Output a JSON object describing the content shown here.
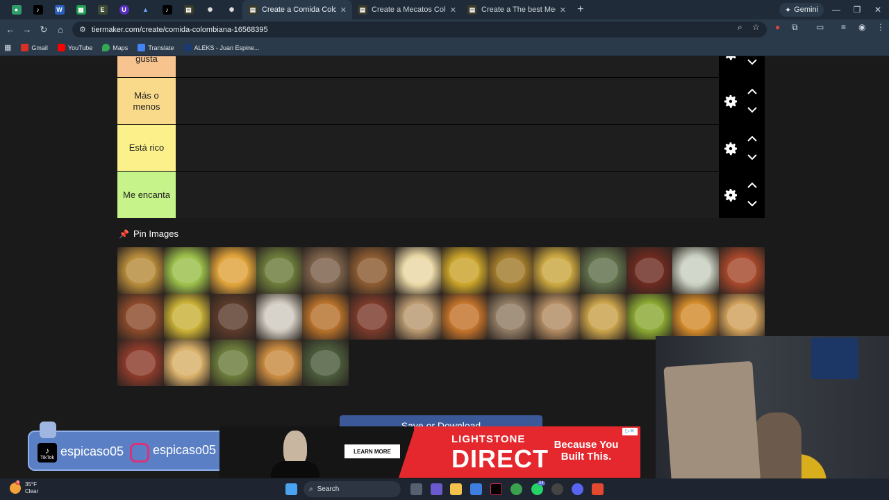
{
  "browser": {
    "tabs": [
      {
        "label": "Create a Comida Colombiana T",
        "active": true
      },
      {
        "label": "Create a Mecatos Colombianos",
        "active": false
      },
      {
        "label": "Create a The best Mecato Tier",
        "active": false
      }
    ],
    "gemini_label": "Gemini",
    "url": "tiermaker.com/create/comida-colombiana-16568395",
    "bookmarks": [
      "Gmail",
      "YouTube",
      "Maps",
      "Translate",
      "ALEKS - Juan Espine..."
    ]
  },
  "tiers": [
    {
      "label": "No me gusta",
      "color": "#f7c38e"
    },
    {
      "label": "Más o menos",
      "color": "#f9d98a"
    },
    {
      "label": "Está rico",
      "color": "#fbf08a"
    },
    {
      "label": "Me encanta",
      "color": "#c7f48a"
    }
  ],
  "pin_images": {
    "title": "Pin Images",
    "count": 33
  },
  "save_button_label": "Save or Download",
  "overlay": {
    "tiktok_handle": "espicaso05",
    "instagram_handle": "espicaso05",
    "tiktok_badge": "TikTok"
  },
  "ad": {
    "learn_more": "LEARN MORE",
    "brand_line1": "LIGHTSTONE",
    "brand_line2": "DIRECT",
    "tagline": "Because You Built This.",
    "choice": "▷✕"
  },
  "taskbar": {
    "temp": "35°F",
    "condition": "Clear",
    "weather_badge": "8",
    "search_label": "Search",
    "whatsapp_badge": "24"
  }
}
